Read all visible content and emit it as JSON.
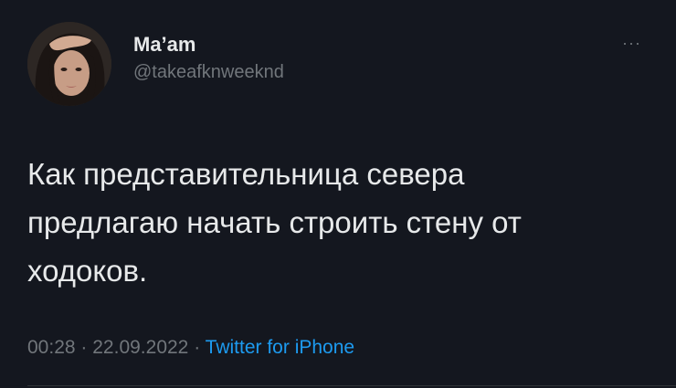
{
  "tweet": {
    "author": {
      "display_name": "Ma’am",
      "handle": "@takeafknweeknd",
      "avatar_icon": "user-photo-avatar"
    },
    "more_icon": "more-horizontal-icon",
    "more_label": "···",
    "text": "Как представительница севера\nпредлагаю начать строить стену от\nходоков.",
    "time": "00:28",
    "separator": "·",
    "date": "22.09.2022",
    "source": "Twitter for iPhone"
  },
  "colors": {
    "background": "#14171f",
    "text": "#e7e9ea",
    "secondary_text": "#71767b",
    "link": "#1d9bf0"
  }
}
